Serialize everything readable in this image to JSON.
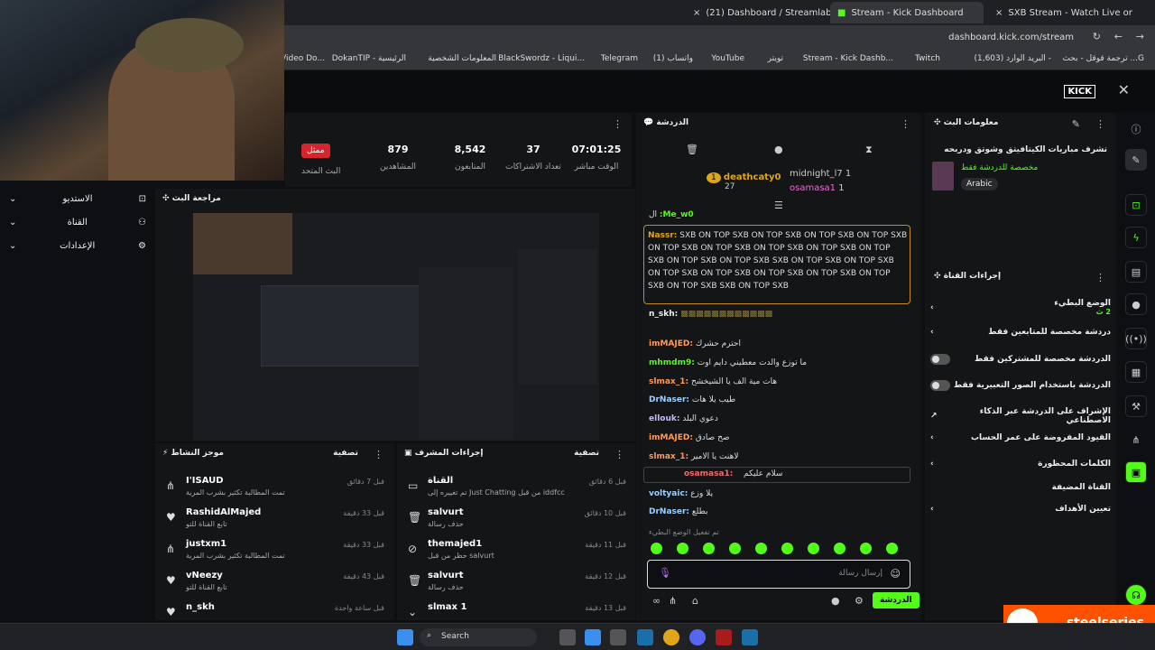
{
  "browser": {
    "tabs": [
      {
        "label": "(21) Dashboard / Streamlabs"
      },
      {
        "label": "Stream - Kick Dashboard"
      },
      {
        "label": "SXB Stream - Watch Live on"
      }
    ],
    "url": "dashboard.kick.com/stream",
    "bookmarks": [
      "ترجمة قوقل - بحث ...G",
      "البريد الوارد (1,603) -",
      "Twitch",
      "Stream - Kick Dashb...",
      "تويتر",
      "YouTube",
      "واتساب (1)",
      "Telegram",
      "BlackSwordz - Liqui...",
      "المعلومات الشخصية",
      "DokanTIP - الرئيسية",
      "e Video Do..."
    ]
  },
  "stats": {
    "live_badge": "ممثل",
    "shared_label": "البث المتحد",
    "items": [
      {
        "value": "879",
        "label": "المشاهدين"
      },
      {
        "value": "8,542",
        "label": "المتابعون"
      },
      {
        "value": "37",
        "label": "تعداد الاشتراكات"
      },
      {
        "value": "07:01:25",
        "label": "الوقت مباشر"
      }
    ]
  },
  "sidenav": {
    "items": [
      "الاستديو",
      "القناة",
      "الإعدادات"
    ]
  },
  "review": {
    "title": "مراجعة البث"
  },
  "chat": {
    "title": "الدردشة",
    "top_users": [
      {
        "name": "deathcaty0",
        "count": "27",
        "rank": "1"
      },
      {
        "name": "midnight_l7",
        "count": "1"
      },
      {
        "name": "osamasa1",
        "count": "1"
      }
    ],
    "messages": [
      {
        "user": "Me_w0:",
        "text": "ال"
      },
      {
        "user": "Nassr:",
        "text": "SXB ON TOP SXB ON TOP SXB ON TOP SXB ON TOP SXB ON TOP SXB ON TOP SXB"
      },
      {
        "user": "",
        "text": "ON TOP SXB ON TOP SXB ON TOP SXB ON TOP SXB ON TOP SXB"
      },
      {
        "user": "",
        "text": "SXB ON TOP SXB ON TOP SXB ON TOP SXB ON TOP SXB"
      },
      {
        "user": "",
        "text": "ON TOP SXB ON TOP SXB ON TOP SXB ON TOP SXB"
      },
      {
        "user": "",
        "text": "SXB ON TOP SXB"
      },
      {
        "user": "n_skh:",
        "text": ""
      },
      {
        "user": "imMAJED:",
        "text": "احترم حشرك"
      },
      {
        "user": "mhmdm9:",
        "text": "ما توزع والدت معطيني دايم اوت"
      },
      {
        "user": "slmax_1:",
        "text": "هات مية الف يا الشيخشح"
      },
      {
        "user": "DrNaser:",
        "text": "طيب يلا هات"
      },
      {
        "user": "ellouk:",
        "text": "دعوي البلد"
      },
      {
        "user": "imMAJED:",
        "text": "صح صادق"
      },
      {
        "user": "slmax_1:",
        "text": "لاهنت يا الامير"
      },
      {
        "user": "osamasa1:",
        "text": "سلام عليكم"
      },
      {
        "user": "voltyaic:",
        "text": "يلا وزع"
      },
      {
        "user": "DrNaser:",
        "text": "بطلع"
      }
    ],
    "slow_mode_notice": "تم تفعيل الوضع البطيء",
    "input_placeholder": "إرسال رسالة",
    "send_label": "الدردشة"
  },
  "stream_info": {
    "title": "معلومات البث",
    "stream_title": "تشرف مباريات الكيتافيتق وشوتق ودربحه",
    "subtitle": "مخصصة للدردشة فقط",
    "language": "Arabic"
  },
  "channel_actions": {
    "title": "إجراءات القناة",
    "items": [
      {
        "label": "الوضع البطيء",
        "sub": "2 ث",
        "control": "chevron"
      },
      {
        "label": "دردشة مخصصة للمتابعين فقط",
        "control": "chevron"
      },
      {
        "label": "الدردشة مخصصة للمشتركين فقط",
        "control": "toggle"
      },
      {
        "label": "الدردشة باستخدام الصور التعبيرية فقط",
        "control": "toggle"
      },
      {
        "label": "الإشراف على الدردشة عبر الذكاء الاصطناعي",
        "control": "link"
      },
      {
        "label": "القيود المفروضة على عمر الحساب",
        "control": "chevron"
      },
      {
        "label": "الكلمات المحظورة",
        "control": "chevron"
      },
      {
        "label": "القناة المضيفة",
        "control": "none"
      },
      {
        "label": "تعيين الأهداف",
        "control": "chevron"
      }
    ]
  },
  "activity_feed": {
    "title": "موجز النشاط",
    "filter": "تصفية",
    "items": [
      {
        "name": "I'ISAUD",
        "desc": "تمت المطالبة تكثير بشرب المرية",
        "time": "قبل 7 دقائق",
        "icon": "share"
      },
      {
        "name": "RashidAlMajed",
        "desc": "تابع القناة للتو",
        "time": "قبل 33 دقيقة",
        "icon": "heart"
      },
      {
        "name": "justxm1",
        "desc": "تمت المطالبة تكثير بشرب المرية",
        "time": "قبل 33 دقيقة",
        "icon": "share"
      },
      {
        "name": "vNeezy",
        "desc": "تابع القناة للتو",
        "time": "قبل 43 دقيقة",
        "icon": "heart"
      },
      {
        "name": "n_skh",
        "desc": "",
        "time": "قبل ساعة واحدة",
        "icon": "heart"
      }
    ]
  },
  "mod_actions": {
    "title": "إجراءات المشرف",
    "filter": "تصفية",
    "items": [
      {
        "name": "القناة",
        "desc": "تم تغييره إلى Just Chatting من قبل iddfcc",
        "time": "قبل 6 دقائق",
        "icon": "tv"
      },
      {
        "name": "salvurt",
        "desc": "حذف رسالة",
        "time": "قبل 10 دقائق",
        "icon": "trash"
      },
      {
        "name": "themajed1",
        "desc": "حظر من قبل salvurt",
        "time": "قبل 11 دقيقة",
        "icon": "ban"
      },
      {
        "name": "salvurt",
        "desc": "حذف رسالة",
        "time": "قبل 12 دقيقة",
        "icon": "trash"
      },
      {
        "name": "slmax 1",
        "desc": "",
        "time": "قبل 13 دقيقة",
        "icon": "down"
      }
    ]
  },
  "taskbar": {
    "search": "Search"
  },
  "overlay": {
    "brand": "steelseries"
  },
  "colors": {
    "accent": "#53fc18",
    "live": "#d6262d",
    "bg": "#0e0f12",
    "panel": "#141517"
  }
}
